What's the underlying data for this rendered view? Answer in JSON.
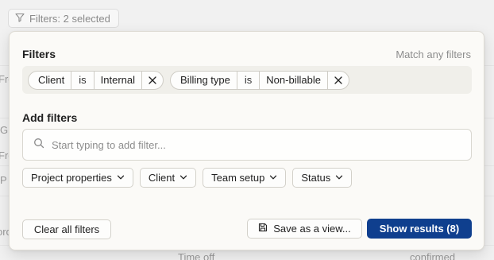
{
  "trigger": {
    "label": "Filters: 2 selected",
    "icon": "funnel-icon"
  },
  "background": {
    "cells": [
      "Fre",
      "G",
      "Fre",
      "P",
      "oro",
      "Time off",
      "confirmed"
    ]
  },
  "popover": {
    "filters_title": "Filters",
    "match_mode": "Match any filters",
    "chips": [
      {
        "field": "Client",
        "operator": "is",
        "value": "Internal"
      },
      {
        "field": "Billing type",
        "operator": "is",
        "value": "Non-billable"
      }
    ],
    "add_filters_title": "Add filters",
    "search": {
      "placeholder": "Start typing to add filter...",
      "value": "",
      "icon": "search-icon"
    },
    "categories": [
      {
        "label": "Project properties"
      },
      {
        "label": "Client"
      },
      {
        "label": "Team setup"
      },
      {
        "label": "Status"
      }
    ],
    "actions": {
      "clear": "Clear all filters",
      "save": "Save as a view...",
      "show": "Show results (8)"
    }
  },
  "colors": {
    "primary": "#0f3f8e",
    "popover_bg": "#fbfaf7",
    "chip_area_bg": "#f0efea"
  }
}
